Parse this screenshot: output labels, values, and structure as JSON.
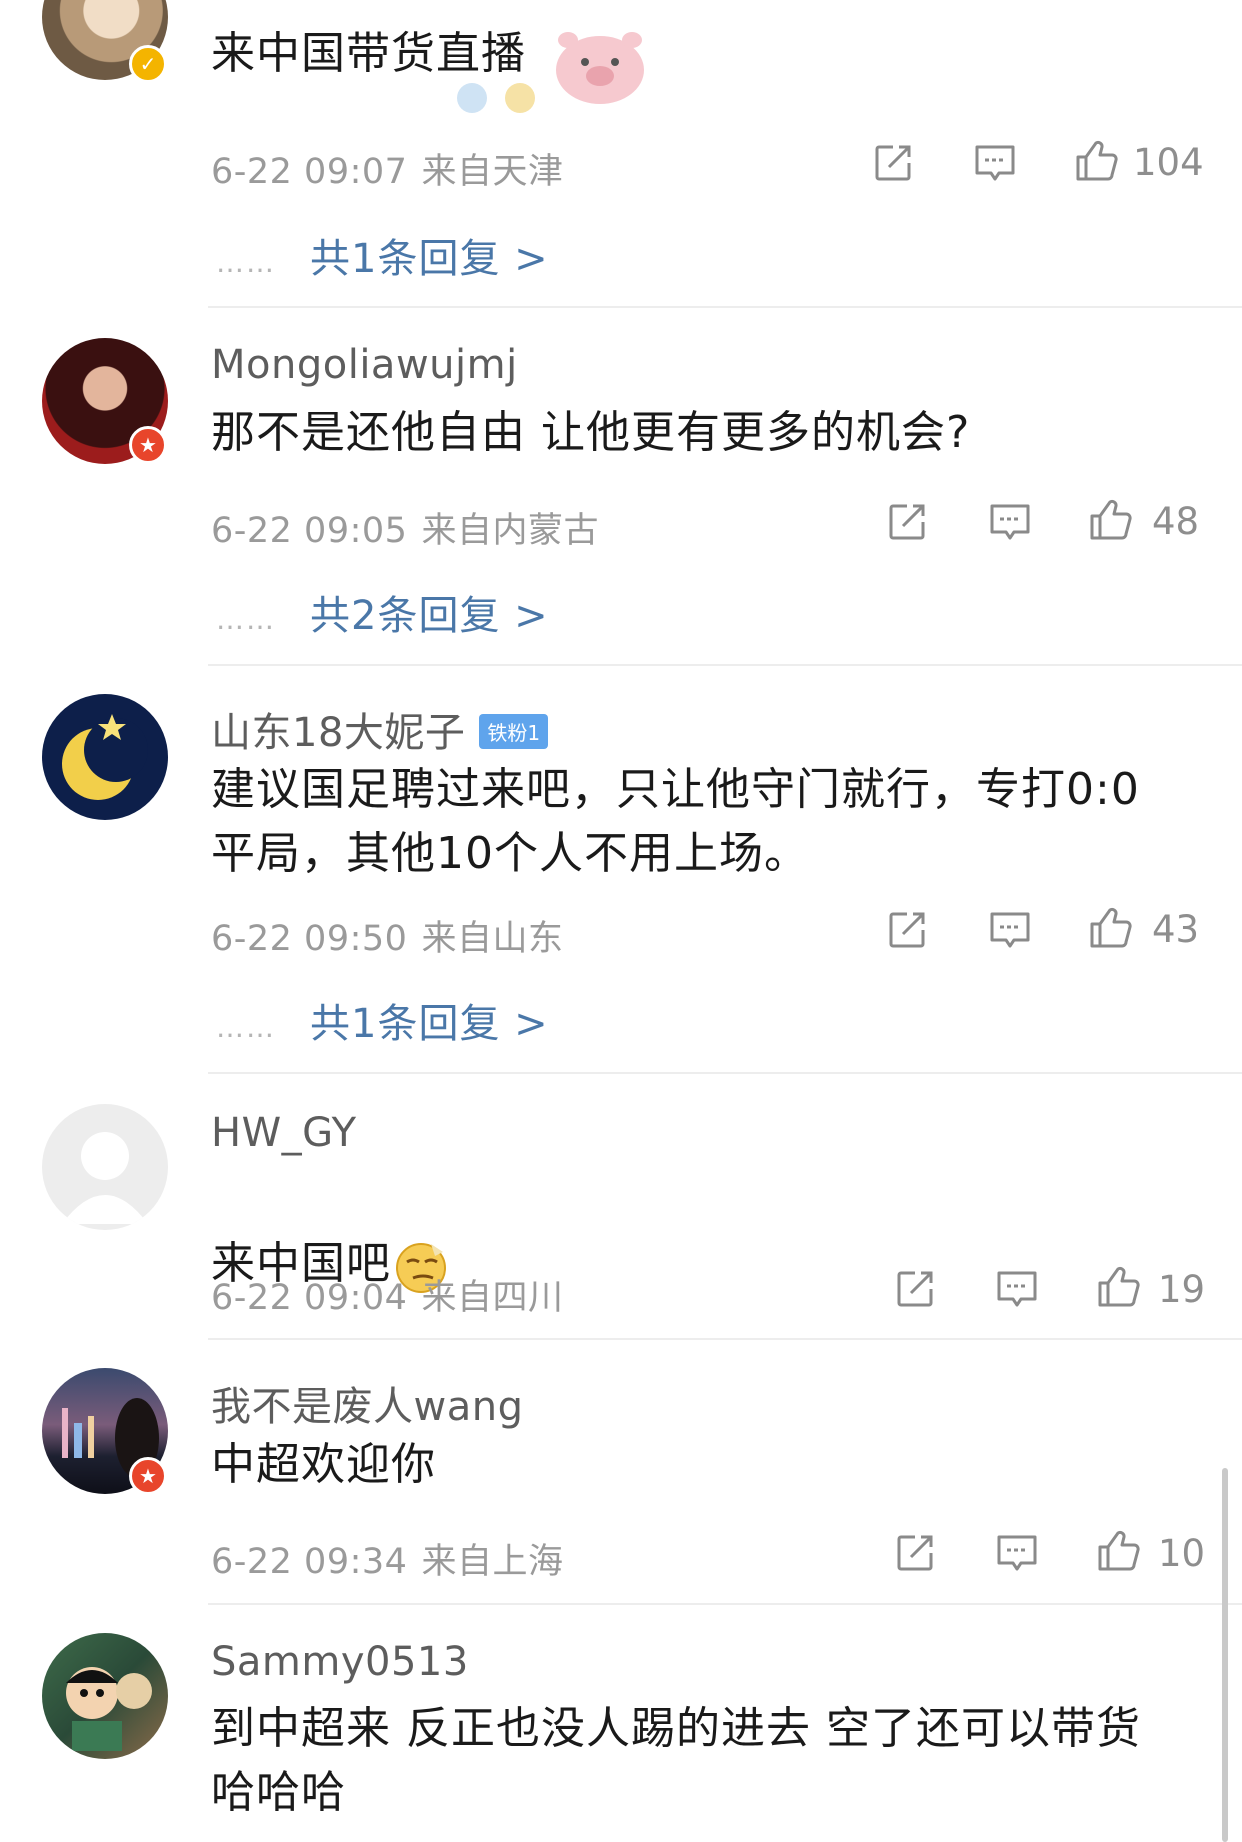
{
  "comments": [
    {
      "username": "",
      "text": "来中国带货直播",
      "date": "6-22 09:07",
      "location": "来自天津",
      "likes": "104",
      "replies": "共1条回复 >"
    },
    {
      "username": "Mongoliawujmj",
      "text": "那不是还他自由 让他更有更多的机会?",
      "date": "6-22 09:05",
      "location": "来自内蒙古",
      "likes": "48",
      "replies": "共2条回复 >"
    },
    {
      "username": "山东18大妮子",
      "fan_badge": "铁粉1",
      "text": "建议国足聘过来吧，只让他守门就行，专打0:0\n平局，其他10个人不用上场。",
      "date": "6-22 09:50",
      "location": "来自山东",
      "likes": "43",
      "replies": "共1条回复 >"
    },
    {
      "username": "HW_GY",
      "text": "来中国吧",
      "date": "6-22 09:04",
      "location": "来自四川",
      "likes": "19"
    },
    {
      "username": "我不是废人wang",
      "text": "中超欢迎你",
      "date": "6-22 09:34",
      "location": "来自上海",
      "likes": "10"
    },
    {
      "username": "Sammy0513",
      "text": "到中超来 反正也没人踢的进去 空了还可以带货\n哈哈哈"
    }
  ],
  "reply_dots": "……",
  "icons": {
    "repost": "repost-icon",
    "comment": "comment-icon",
    "like": "thumbs-up-icon"
  },
  "colors": {
    "reply_link": "#4a77a8",
    "meta_text": "#9a9a9a",
    "badge_red": "#e8452b",
    "badge_gold": "#f4b400"
  }
}
